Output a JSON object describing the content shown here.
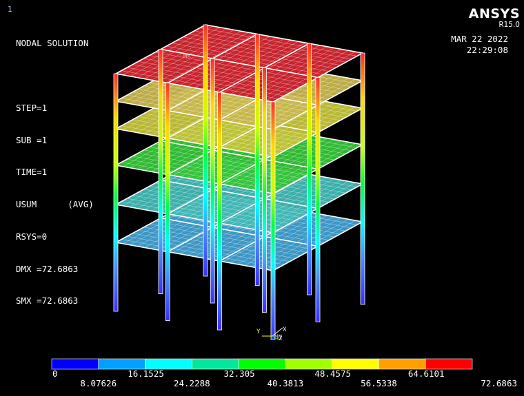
{
  "window_number": "1",
  "header_lines": [
    "NODAL SOLUTION",
    "",
    "STEP=1",
    "SUB =1",
    "TIME=1",
    "USUM      (AVG)",
    "RSYS=0",
    "DMX =72.6863",
    "SMX =72.6863"
  ],
  "brand": {
    "name": "ANSYS",
    "version": "R15.0"
  },
  "date": "MAR 22 2022",
  "time": "22:29:08",
  "model_labels": {
    "max_marker": "MX",
    "min_marker": "MN"
  },
  "triad": {
    "y": "Y",
    "z": "Z",
    "x": "X"
  },
  "legend": {
    "colors": [
      "#0000ff",
      "#00a0ff",
      "#00ffff",
      "#00e8a0",
      "#00ff00",
      "#a0ff00",
      "#ffff00",
      "#ffa000",
      "#ff0000"
    ],
    "upper_labels": [
      "0",
      "16.1525",
      "32.305",
      "48.4575",
      "64.6101"
    ],
    "lower_labels": [
      "8.07626",
      "24.2288",
      "40.3813",
      "56.5338",
      "72.6863"
    ]
  },
  "floor_colors": {
    "roof": "#c8242e",
    "level_5": "#c7b54a",
    "level_4": "#c3c236",
    "level_3": "#33c436",
    "level_2": "#3fb8b4",
    "level_1": "#3f9fd0"
  }
}
